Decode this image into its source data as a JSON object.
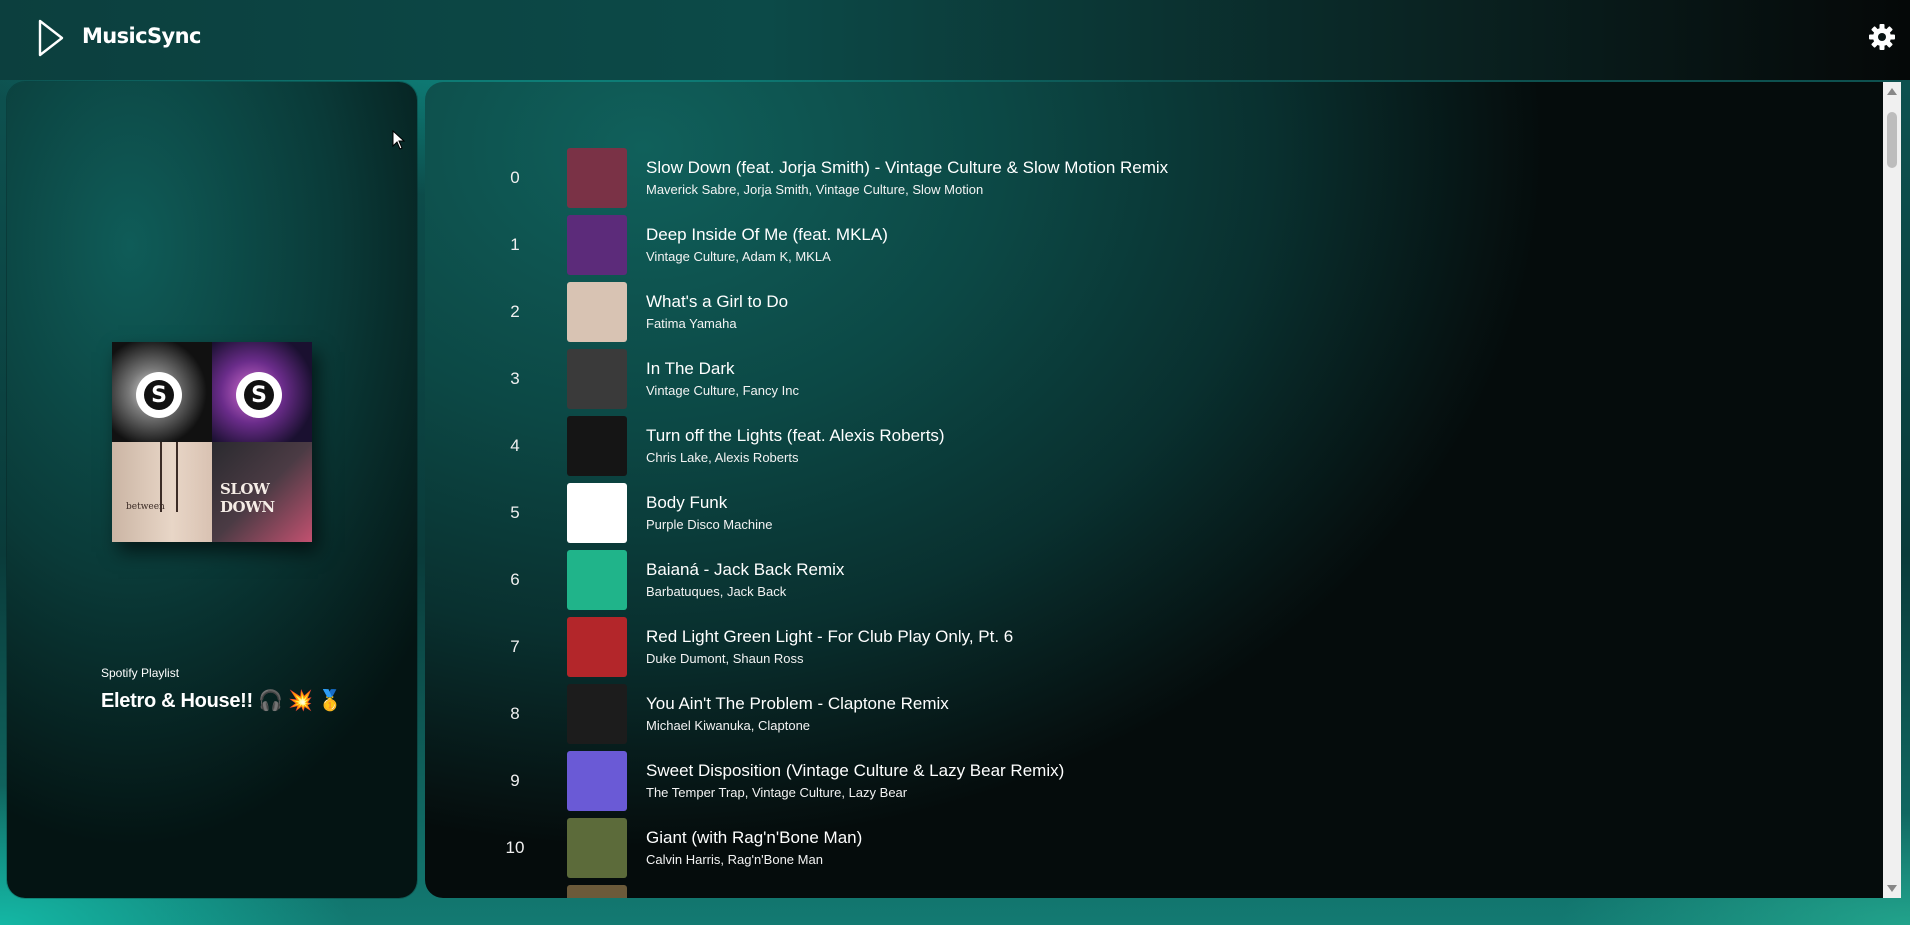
{
  "app": {
    "title": "MusicSync"
  },
  "header": {
    "logo_icon": "play-triangle-icon",
    "settings_icon": "gear-icon"
  },
  "sidebar": {
    "playlist_type": "Spotify Playlist",
    "playlist_name": "Eletro & House!! 🎧 💥 🥇",
    "cover": {
      "tile3_text": "between",
      "tile4_text": "SLOW DOWN"
    }
  },
  "tracks": [
    {
      "num": "0",
      "title": "Slow Down (feat. Jorja Smith) - Vintage Culture & Slow Motion Remix",
      "artists": "Maverick Sabre, Jorja Smith, Vintage Culture, Slow Motion",
      "thumb_color": "#7a3246"
    },
    {
      "num": "1",
      "title": "Deep Inside Of Me (feat. MKLA)",
      "artists": "Vintage Culture, Adam K, MKLA",
      "thumb_color": "#5c2b7a"
    },
    {
      "num": "2",
      "title": "What's a Girl to Do",
      "artists": "Fatima Yamaha",
      "thumb_color": "#d8c3b3"
    },
    {
      "num": "3",
      "title": "In The Dark",
      "artists": "Vintage Culture, Fancy Inc",
      "thumb_color": "#3a3a3a"
    },
    {
      "num": "4",
      "title": "Turn off the Lights (feat. Alexis Roberts)",
      "artists": "Chris Lake, Alexis Roberts",
      "thumb_color": "#151515"
    },
    {
      "num": "5",
      "title": "Body Funk",
      "artists": "Purple Disco Machine",
      "thumb_color": "#ffffff"
    },
    {
      "num": "6",
      "title": "Baianá - Jack Back Remix",
      "artists": "Barbatuques, Jack Back",
      "thumb_color": "#20b48a"
    },
    {
      "num": "7",
      "title": "Red Light Green Light - For Club Play Only, Pt. 6",
      "artists": "Duke Dumont, Shaun Ross",
      "thumb_color": "#b3262a"
    },
    {
      "num": "8",
      "title": "You Ain't The Problem - Claptone Remix",
      "artists": "Michael Kiwanuka, Claptone",
      "thumb_color": "#1c1c1c"
    },
    {
      "num": "9",
      "title": "Sweet Disposition (Vintage Culture & Lazy Bear Remix)",
      "artists": "The Temper Trap, Vintage Culture, Lazy Bear",
      "thumb_color": "#6a5ad6"
    },
    {
      "num": "10",
      "title": "Giant (with Rag'n'Bone Man)",
      "artists": "Calvin Harris, Rag'n'Bone Man",
      "thumb_color": "#5c6b3a"
    },
    {
      "num": "",
      "title": "",
      "artists": "",
      "thumb_color": "#6b5a3a"
    }
  ]
}
